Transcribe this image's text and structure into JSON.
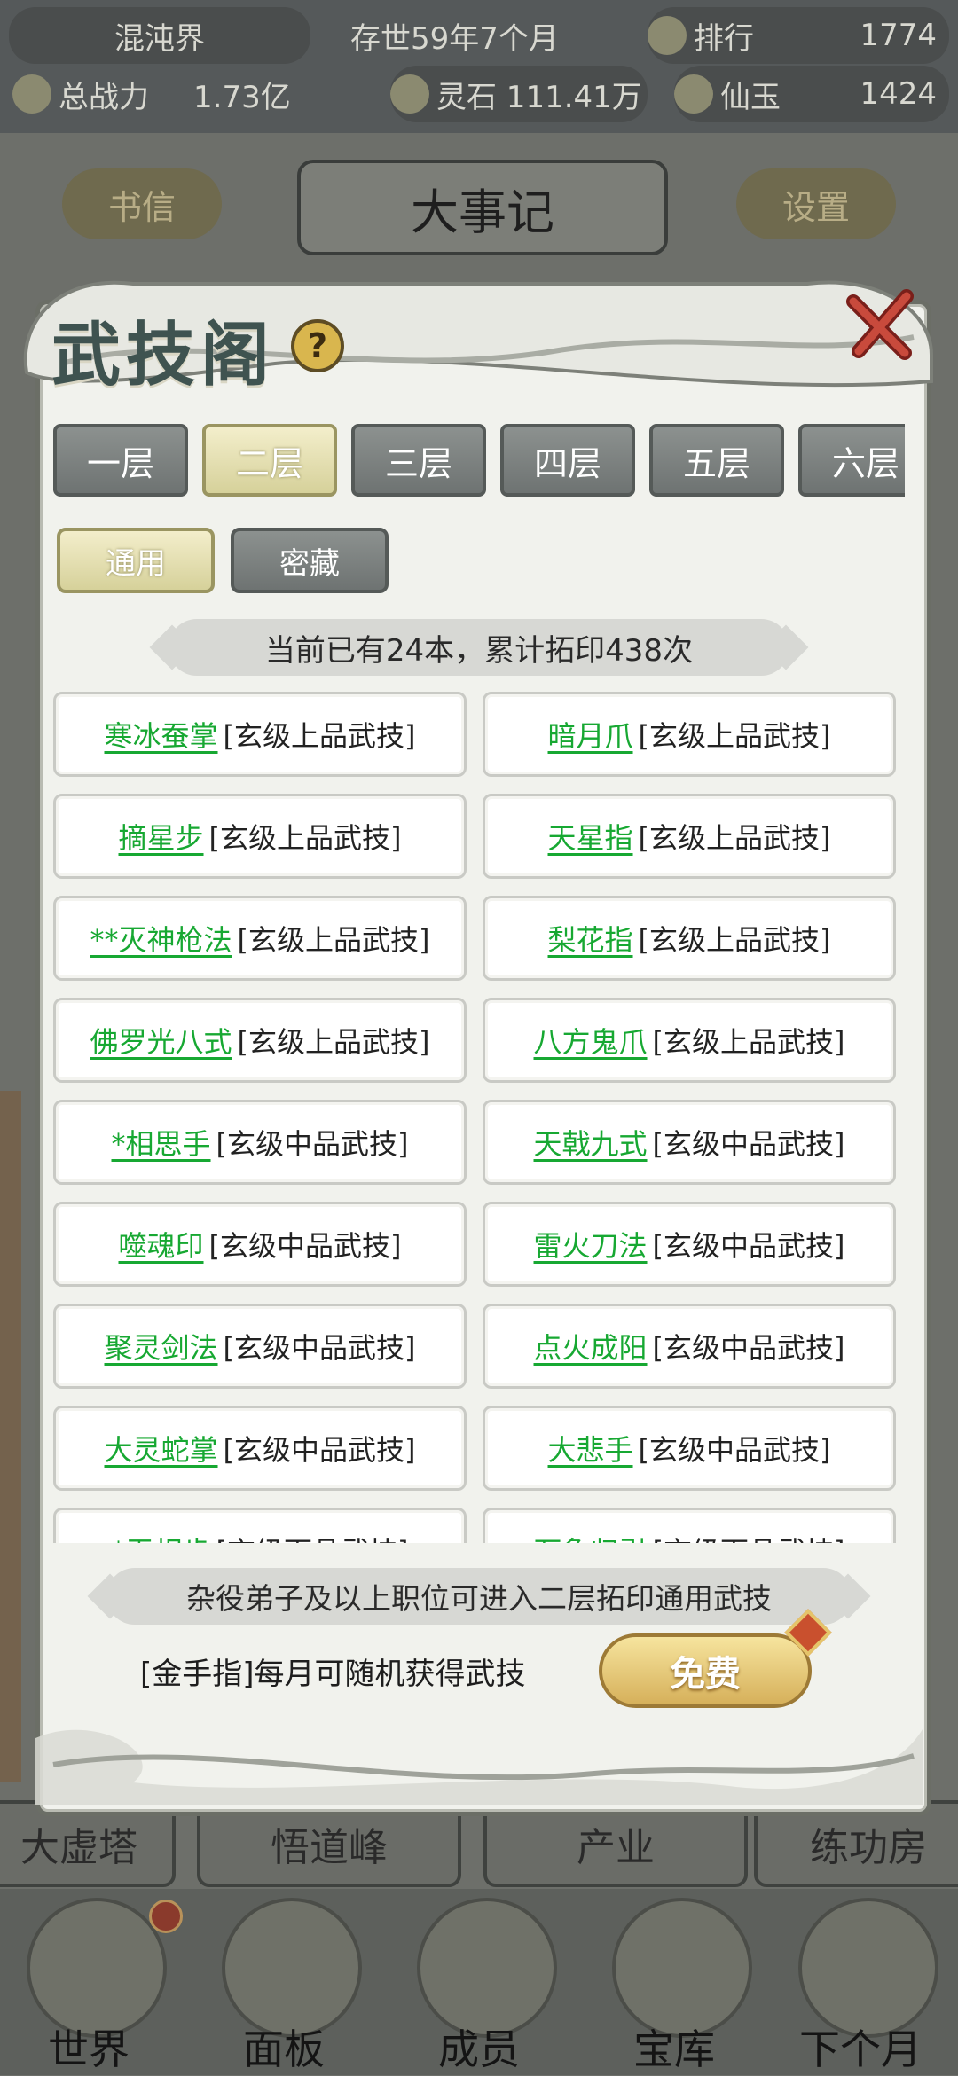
{
  "topbar": {
    "realm": "混沌界",
    "age": "存世59年7个月",
    "rank_label": "排行",
    "rank_value": "1774",
    "power_label": "总战力",
    "power_value": "1.73亿",
    "stone": "灵石 111.41万",
    "jade_label": "仙玉",
    "jade_value": "1424"
  },
  "background": {
    "left_button": "书信",
    "title": "大事记",
    "right_button": "设置",
    "tabs": [
      "大虚塔",
      "悟道峰",
      "产业",
      "练功房"
    ],
    "nav": [
      "世界",
      "面板",
      "成员",
      "宝库",
      "下个月"
    ]
  },
  "modal": {
    "title": "武技阁",
    "help": "?",
    "layers": [
      "一层",
      "二层",
      "三层",
      "四层",
      "五层",
      "六层"
    ],
    "active_layer": 1,
    "types": [
      "通用",
      "密藏"
    ],
    "active_type": 0,
    "count_text": "当前已有24本，累计拓印438次",
    "skills": [
      {
        "name": "寒冰蚕掌",
        "grade": "[玄级上品武技]"
      },
      {
        "name": "暗月爪",
        "grade": "[玄级上品武技]"
      },
      {
        "name": "摘星步",
        "grade": "[玄级上品武技]"
      },
      {
        "name": "天星指",
        "grade": "[玄级上品武技]"
      },
      {
        "name": "**灭神枪法",
        "grade": "[玄级上品武技]"
      },
      {
        "name": "梨花指",
        "grade": "[玄级上品武技]"
      },
      {
        "name": "佛罗光八式",
        "grade": "[玄级上品武技]"
      },
      {
        "name": "八方鬼爪",
        "grade": "[玄级上品武技]"
      },
      {
        "name": "*相思手",
        "grade": "[玄级中品武技]"
      },
      {
        "name": "天戟九式",
        "grade": "[玄级中品武技]"
      },
      {
        "name": "噬魂印",
        "grade": "[玄级中品武技]"
      },
      {
        "name": "雷火刀法",
        "grade": "[玄级中品武技]"
      },
      {
        "name": "聚灵剑法",
        "grade": "[玄级中品武技]"
      },
      {
        "name": "点火成阳",
        "grade": "[玄级中品武技]"
      },
      {
        "name": "大灵蛇掌",
        "grade": "[玄级中品武技]"
      },
      {
        "name": "大悲手",
        "grade": "[玄级中品武技]"
      },
      {
        "name": "*无相步",
        "grade": "[玄级下品武技]"
      },
      {
        "name": "万象归引",
        "grade": "[玄级下品武技]"
      }
    ],
    "footer_note": "杂役弟子及以上职位可进入二层拓印通用武技",
    "gold_finger_text": "[金手指]每月可随机获得武技",
    "free_button": "免费"
  }
}
